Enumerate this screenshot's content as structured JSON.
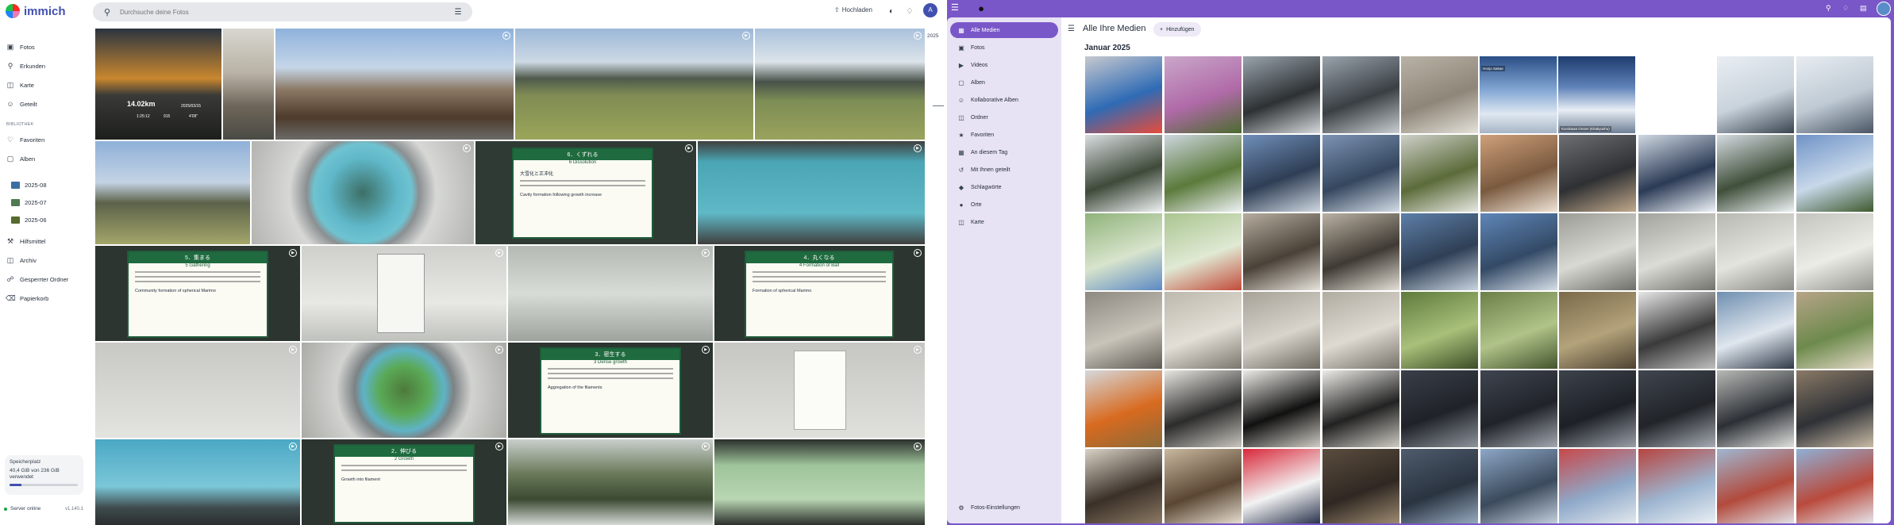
{
  "left_app": {
    "logo_text": "immich",
    "search_placeholder": "Durchsuche deine Fotos",
    "upload_label": "Hochladen",
    "avatar_initial": "A",
    "nav": [
      {
        "label": "Fotos",
        "icon": "image-icon"
      },
      {
        "label": "Erkunden",
        "icon": "magnify-icon"
      },
      {
        "label": "Karte",
        "icon": "map-icon"
      },
      {
        "label": "Geteilt",
        "icon": "people-icon"
      }
    ],
    "library_heading": "BIBLIOTHEK",
    "library": [
      {
        "label": "Favoriten",
        "icon": "heart-icon"
      },
      {
        "label": "Alben",
        "icon": "album-icon"
      }
    ],
    "albums": [
      {
        "label": "2025-08",
        "color": "#3b6fa0"
      },
      {
        "label": "2025-07",
        "color": "#4f7a52"
      },
      {
        "label": "2025-06",
        "color": "#556b2f"
      }
    ],
    "more": [
      {
        "label": "Hilfsmittel",
        "icon": "tools-icon"
      },
      {
        "label": "Archiv",
        "icon": "archive-icon"
      },
      {
        "label": "Gesperrter Ordner",
        "icon": "lock-icon"
      },
      {
        "label": "Papierkorb",
        "icon": "trash-icon"
      }
    ],
    "storage": {
      "title": "Speicherplatz",
      "text": "40,4 GiB von 236 GiB verwendet",
      "fraction": 0.17
    },
    "status": {
      "text": "Server online",
      "version": "v1.140.1"
    },
    "year_label": "2025",
    "overlay": {
      "distance": "14.02km",
      "line1": "1:25:12",
      "line2": "915",
      "line3": "4'09\"",
      "date": "2025/03/15"
    },
    "signs": {
      "s1_title": "6．くずれる",
      "s1_sub": "6 Dissolution",
      "s1_jp": "大雪化と正冲化",
      "s1_en": "Cavity formation following growth increase",
      "s2_title": "5．集まる",
      "s2_sub": "5 Gathering",
      "s2_en": "Community formation of spherical Marimo",
      "s3_title": "4．丸くなる",
      "s3_sub": "4 Formation of Ball",
      "s3_en": "Formation of spherical Marimo",
      "s4_title": "3．密生する",
      "s4_sub": "3 Dense growth",
      "s4_en": "Aggregation of the filaments",
      "s5_title": "2．伸びる",
      "s5_sub": "2 Growth",
      "s5_en": "Growth into filament"
    }
  },
  "right_app": {
    "nav": [
      {
        "label": "Alle Medien",
        "icon": "grid-icon",
        "active": true
      },
      {
        "label": "Fotos",
        "icon": "image-icon"
      },
      {
        "label": "Videos",
        "icon": "video-icon"
      },
      {
        "label": "Alben",
        "icon": "album-icon"
      },
      {
        "label": "Kollaborative Alben",
        "icon": "group-icon"
      },
      {
        "label": "Ordner",
        "icon": "folder-icon"
      },
      {
        "label": "Favoriten",
        "icon": "star-icon"
      },
      {
        "label": "An diesem Tag",
        "icon": "calendar-icon"
      },
      {
        "label": "Mit Ihnen geteilt",
        "icon": "share-icon"
      },
      {
        "label": "Schlagwörte",
        "icon": "tag-icon"
      },
      {
        "label": "Orte",
        "icon": "pin-icon"
      },
      {
        "label": "Karte",
        "icon": "map-icon"
      }
    ],
    "settings_label": "Fotos-Einstellungen",
    "page_title": "Alle Ihre Medien",
    "add_label": "Hinzufügen",
    "month_label": "Januar 2025",
    "cell_labels": {
      "c7": "Kurokawa Onsen (Kitakyushu)",
      "c8": "Honjo Sakae"
    }
  }
}
